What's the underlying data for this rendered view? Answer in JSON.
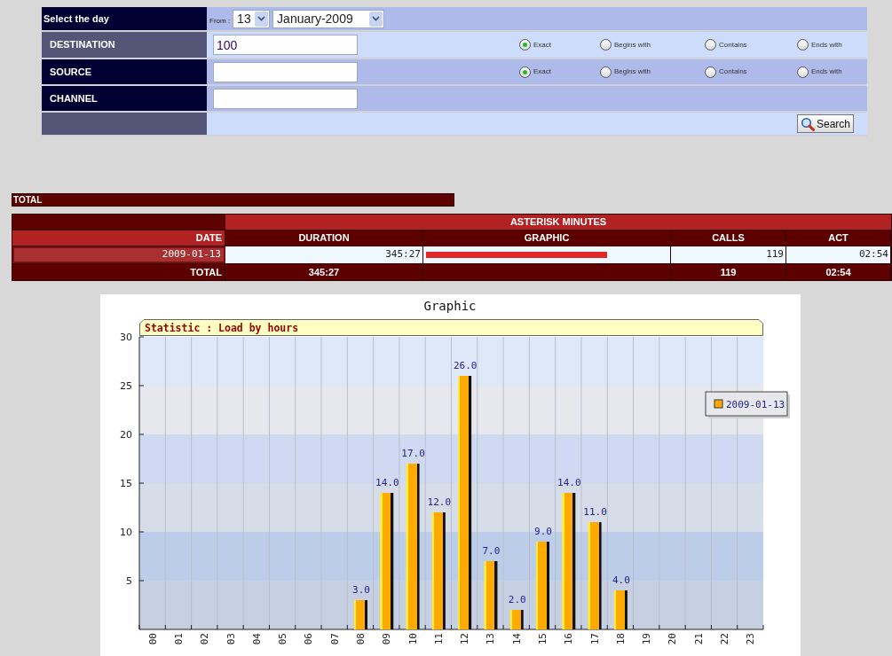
{
  "filters": {
    "day": {
      "label": "Select the day",
      "from_label": "From :",
      "day": "13",
      "month": "January-2009"
    },
    "fields": [
      {
        "label": "DESTINATION",
        "value": "100",
        "options": [
          {
            "label": "Exact",
            "selected": true
          },
          {
            "label": "Begins with",
            "selected": false
          },
          {
            "label": "Contains",
            "selected": false
          },
          {
            "label": "Ends with",
            "selected": false
          }
        ]
      },
      {
        "label": "SOURCE",
        "options": [
          {
            "label": "Exact",
            "selected": true
          },
          {
            "label": "Begins with",
            "selected": false
          },
          {
            "label": "Contains",
            "selected": false
          },
          {
            "label": "Ends with",
            "selected": false
          }
        ]
      },
      {
        "label": "CHANNEL"
      }
    ],
    "search_button": "Search"
  },
  "total_bar": "TOTAL",
  "minutes_table": {
    "group_heading": "ASTERISK MINUTES",
    "columns": [
      "DATE",
      "DURATION",
      "GRAPHIC",
      "CALLS",
      "ACT"
    ],
    "rows": [
      {
        "date": "2009-01-13",
        "duration": "345:27",
        "level": 0.75,
        "calls": "119",
        "act": "02:54"
      }
    ],
    "total": {
      "label": "TOTAL",
      "duration": "345:27",
      "calls": "119",
      "act": "02:54"
    }
  },
  "chart": {
    "title": "Graphic",
    "chart_data": {
      "type": "bar",
      "title": "Statistic : Load by hours",
      "categories": [
        "00",
        "01",
        "02",
        "03",
        "04",
        "05",
        "06",
        "07",
        "08",
        "09",
        "10",
        "11",
        "12",
        "13",
        "14",
        "15",
        "16",
        "17",
        "18",
        "19",
        "20",
        "21",
        "22",
        "23"
      ],
      "series": [
        {
          "name": "2009-01-13",
          "color": "#ffaa00",
          "values": [
            0,
            0,
            0,
            0,
            0,
            0,
            0,
            0,
            3,
            14,
            17,
            12,
            26,
            7,
            2,
            9,
            14,
            11,
            4,
            0,
            0,
            0,
            0,
            0
          ]
        }
      ],
      "ylim": [
        0,
        30
      ],
      "yticks": [
        5,
        10,
        15,
        20,
        25,
        30
      ],
      "value_labels": [
        "3.0",
        "14.0",
        "17.0",
        "12.0",
        "26.0",
        "7.0",
        "2.0",
        "9.0",
        "14.0",
        "11.0",
        "4.0"
      ]
    }
  }
}
